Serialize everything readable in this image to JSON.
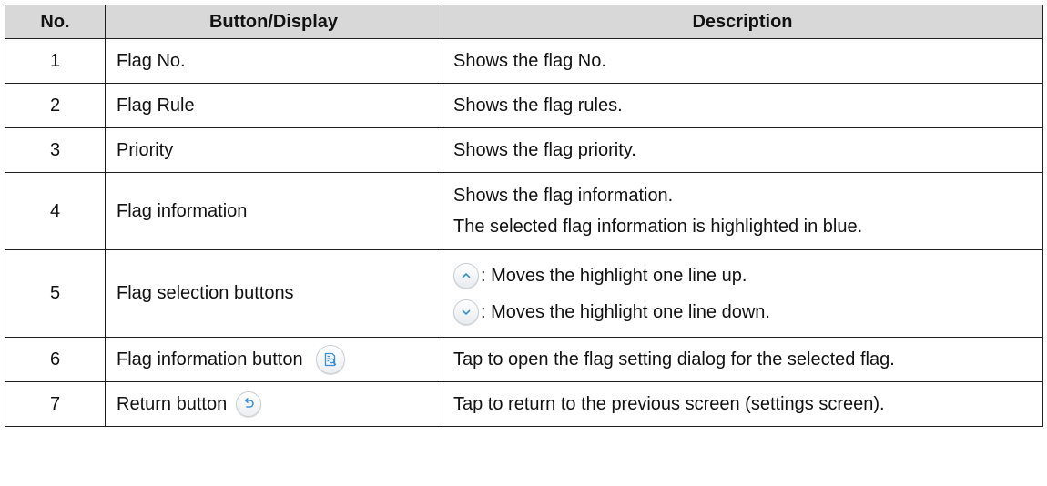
{
  "table": {
    "headers": {
      "no": "No.",
      "button": "Button/Display",
      "description": "Description"
    },
    "rows": [
      {
        "no": "1",
        "button": "Flag No.",
        "description": "Shows the flag No."
      },
      {
        "no": "2",
        "button": "Flag Rule",
        "description": "Shows the flag rules."
      },
      {
        "no": "3",
        "button": "Priority",
        "description": "Shows the flag priority."
      },
      {
        "no": "4",
        "button": "Flag information",
        "description_line1": "Shows the flag information.",
        "description_line2": "The selected flag information is highlighted in blue."
      },
      {
        "no": "5",
        "button": "Flag selection buttons",
        "up_text": ": Moves the highlight one line up.",
        "down_text": ": Moves the highlight one line down."
      },
      {
        "no": "6",
        "button": "Flag information button",
        "description": "Tap to open the flag setting dialog for the selected flag."
      },
      {
        "no": "7",
        "button": "Return button",
        "description": "Tap to return to the previous screen (settings screen)."
      }
    ]
  },
  "icons": {
    "up": "chevron-up-icon",
    "down": "chevron-down-icon",
    "flag_info": "document-search-icon",
    "return": "undo-arrow-icon"
  },
  "colors": {
    "icon_blue": "#3a8fd8",
    "header_bg": "#d8d8d8"
  }
}
